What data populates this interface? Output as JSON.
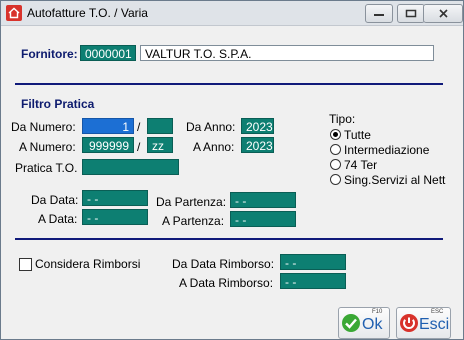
{
  "window": {
    "title": "Autofatture T.O. / Varia"
  },
  "fornitore": {
    "label": "Fornitore:",
    "code": "0000001",
    "name": "VALTUR T.O. S.P.A."
  },
  "filtro": {
    "heading": "Filtro Pratica",
    "da_numero_label": "Da Numero:",
    "da_numero": "1",
    "da_numero_sep": "/",
    "da_numero_suffix": "",
    "a_numero_label": "A Numero:",
    "a_numero": "999999",
    "a_numero_sep": "/",
    "a_numero_suffix": "zz",
    "da_anno_label": "Da Anno:",
    "da_anno": "2023",
    "a_anno_label": "A Anno:",
    "a_anno": "2023",
    "pratica_to_label": "Pratica T.O.",
    "pratica_to": "",
    "da_data_label": "Da Data:",
    "da_data": "- -",
    "a_data_label": "A Data:",
    "a_data": "- -",
    "da_partenza_label": "Da Partenza:",
    "da_partenza": "- -",
    "a_partenza_label": "A Partenza:",
    "a_partenza": "- -"
  },
  "tipo": {
    "label": "Tipo:",
    "options": [
      "Tutte",
      "Intermediazione",
      "74 Ter",
      "Sing.Servizi al Nett"
    ],
    "selected": "Tutte"
  },
  "rimborsi": {
    "checkbox_label": "Considera Rimborsi",
    "checked": false,
    "da_label": "Da Data Rimborso:",
    "da_value": "- -",
    "a_label": "A Data Rimborso:",
    "a_value": "- -"
  },
  "buttons": {
    "ok": {
      "key": "F10",
      "label": "Ok"
    },
    "esci": {
      "key": "ESC",
      "label": "Esci"
    }
  },
  "colors": {
    "field": "#0d7f72",
    "selected_field": "#1c6fd4",
    "heading": "#0d1b6e",
    "divider": "#101a7a"
  }
}
